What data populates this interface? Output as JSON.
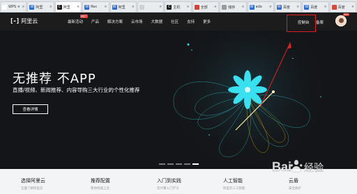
{
  "browser": {
    "tabs": [
      {
        "label": "WPS ×",
        "favicon_color": "#ffffff",
        "favicon_text": "",
        "active": false
      },
      {
        "label": "阿里",
        "favicon_color": "#2d6bd6",
        "favicon_text": "W",
        "active": false
      },
      {
        "label": "阿里",
        "favicon_color": "#1c1c1d",
        "favicon_text": "C",
        "active": true
      },
      {
        "label": "Rec",
        "favicon_color": "#2d6bd6",
        "favicon_text": "W",
        "active": false
      },
      {
        "label": "阿里",
        "favicon_color": "#2d6bd6",
        "favicon_text": "W",
        "active": false
      },
      {
        "label": "",
        "favicon_color": "#cfcfcf",
        "favicon_text": "",
        "active": false
      },
      {
        "label": "主机",
        "favicon_color": "#1c1c1d",
        "favicon_text": "C",
        "active": false
      },
      {
        "label": "全部",
        "favicon_color": "#e23b30",
        "favicon_text": "",
        "active": false
      },
      {
        "label": "储存",
        "favicon_color": "#9a9a9a",
        "favicon_text": "",
        "active": false
      },
      {
        "label": "ado",
        "favicon_color": "#2d6bd6",
        "favicon_text": "W",
        "active": false
      },
      {
        "label": "百度",
        "favicon_color": "#2d6bd6",
        "favicon_text": "W",
        "active": false
      },
      {
        "label": "百度",
        "favicon_color": "#2d6bd6",
        "favicon_text": "W",
        "active": false
      },
      {
        "label": "百度",
        "favicon_color": "#d64a3b",
        "favicon_text": "",
        "active": false
      }
    ]
  },
  "header": {
    "logo_mark": "[-]",
    "logo_text": "阿里云",
    "nav": [
      "最新活动",
      "产品",
      "解决方案",
      "云市场",
      "大数据",
      "社区",
      "支持",
      "更多"
    ],
    "hot_badge": "HOT",
    "console_label": "控制台",
    "beian_label": "备案",
    "avatar_badge": "99+",
    "highlight_color": "#e02020"
  },
  "hero": {
    "title": "无推荐 不APP",
    "subtitle": "直播/视频、新闻推荐、内容导购三大行业的个性化推荐",
    "button_label": "查看详情",
    "slide_count": 5,
    "active_slide": 4,
    "accent_colors": [
      "#38e0f0",
      "#f5c400",
      "#2ec4c4"
    ]
  },
  "cards": [
    {
      "title": "选择阿里云",
      "sub": "全面了解阿里云"
    },
    {
      "title": "推荐配置",
      "sub": "帮你快速上云"
    },
    {
      "title": "入门到实践",
      "sub": "云计算入门学习"
    },
    {
      "title": "人工智能",
      "sub": "阿里云人工智能"
    },
    {
      "title": "云盾",
      "sub": "安全防护"
    }
  ],
  "watermark": "Bai 经验"
}
